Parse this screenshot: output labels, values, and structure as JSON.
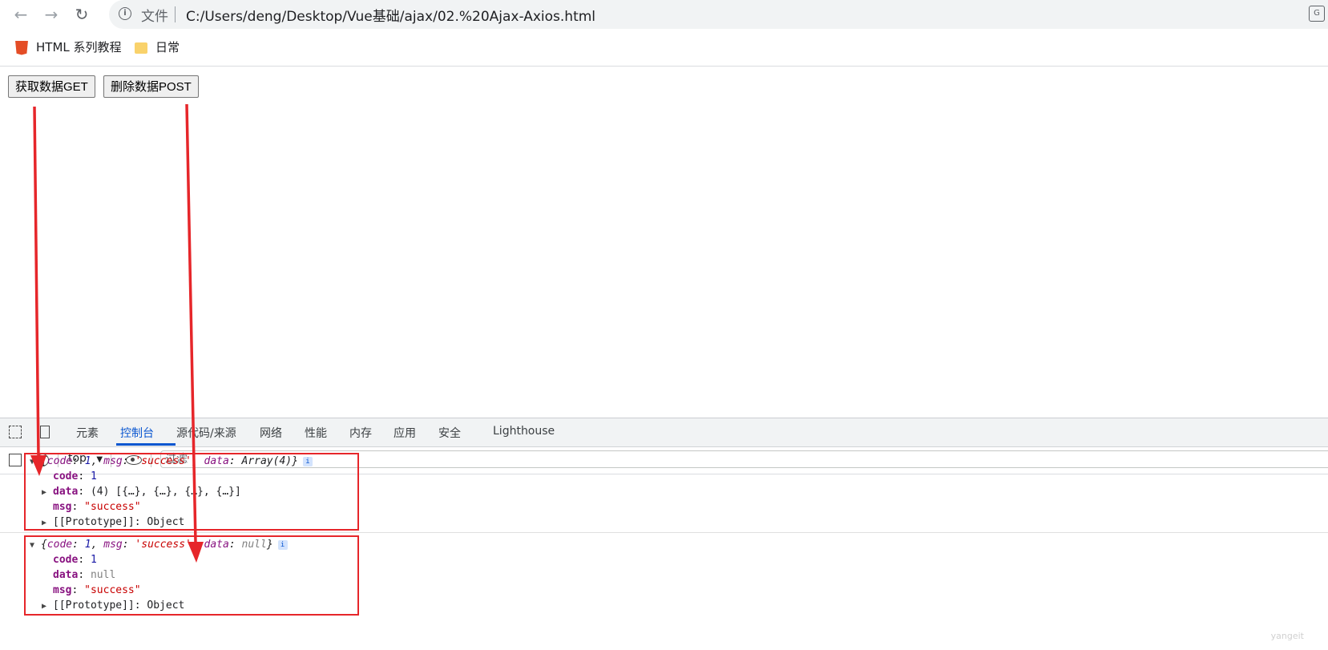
{
  "browser": {
    "back_icon": "arrow-left-icon",
    "forward_icon": "arrow-right-icon",
    "reload_icon": "reload-icon",
    "scheme_label": "文件",
    "url": "C:/Users/deng/Desktop/Vue基础/ajax/02.%20Ajax-Axios.html"
  },
  "bookmarks": [
    {
      "label": "HTML 系列教程",
      "icon": "html5-icon"
    },
    {
      "label": "日常",
      "icon": "folder-icon"
    }
  ],
  "page": {
    "get_button": "获取数据GET",
    "post_button": "删除数据POST"
  },
  "devtools": {
    "tabs": [
      "元素",
      "控制台",
      "源代码/来源",
      "网络",
      "性能",
      "内存",
      "应用",
      "安全",
      "Lighthouse"
    ],
    "active_tab": "控制台",
    "context": "top",
    "filter_placeholder": "过滤"
  },
  "console": {
    "entry1": {
      "summary": {
        "code": "1",
        "msg": "'success'",
        "data": "Array(4)"
      },
      "code": "1",
      "data": "(4) [{…}, {…}, {…}, {…}]",
      "msg": "\"success\"",
      "proto": "Object"
    },
    "entry2": {
      "summary": {
        "code": "1",
        "msg": "'success'",
        "data": "null"
      },
      "code": "1",
      "data": "null",
      "msg": "\"success\"",
      "proto": "Object"
    }
  },
  "colors": {
    "annotation": "#e6262a",
    "active_tab": "#0b57d0"
  },
  "watermark": "yangeit"
}
